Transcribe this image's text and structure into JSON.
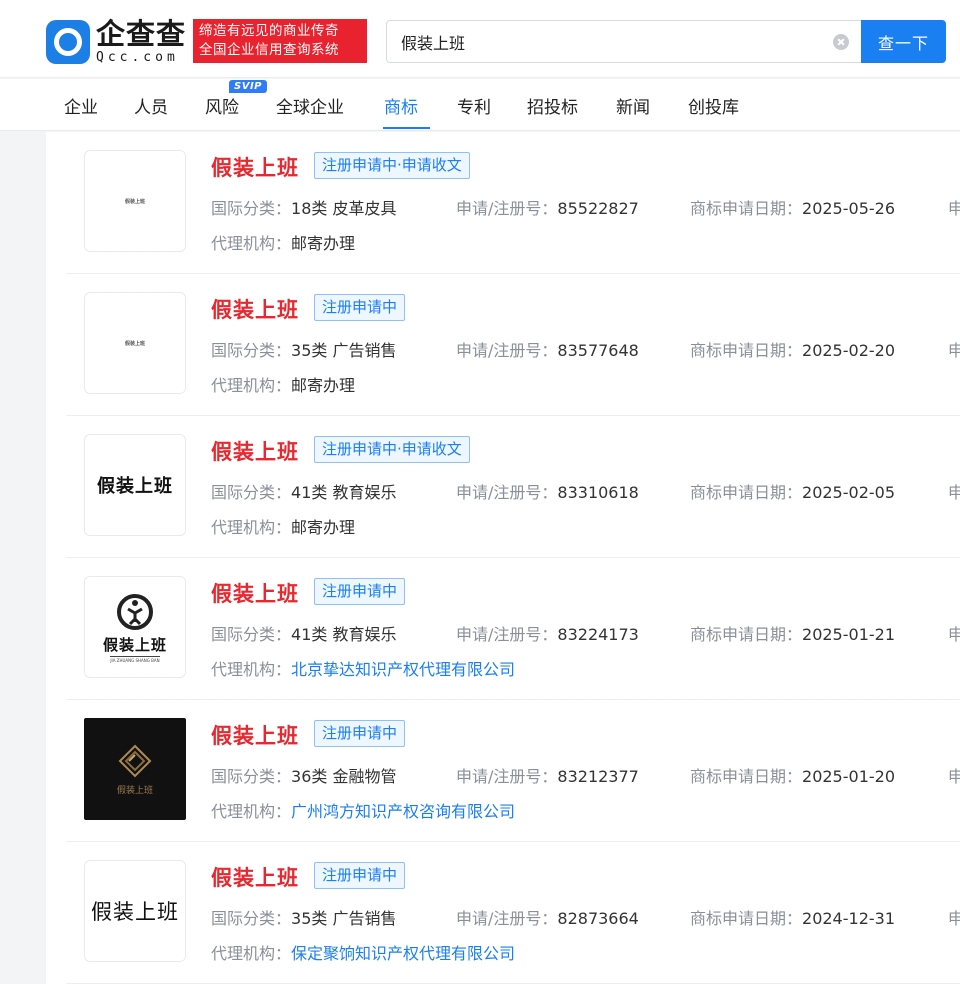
{
  "header": {
    "logo_name": "企查查",
    "logo_domain": "Qcc.com",
    "slogan_line1": "缔造有远见的商业传奇",
    "slogan_line2": "全国企业信用查询系统",
    "search_value": "假装上班",
    "search_button": "查一下"
  },
  "nav": {
    "svip": "SVIP",
    "tabs": [
      "企业",
      "人员",
      "风险",
      "全球企业",
      "商标",
      "专利",
      "招投标",
      "新闻",
      "创投库"
    ],
    "active": "商标"
  },
  "labels": {
    "class": "国际分类：",
    "regno": "申请/注册号：",
    "date": "商标申请日期：",
    "agency": "代理机构：",
    "cutoff": "申"
  },
  "items": [
    {
      "name": "假装上班",
      "status": "注册申请中·申请收文",
      "class": "18类 皮革皮具",
      "regno": "85522827",
      "date": "2025-05-26",
      "agency": "邮寄办理",
      "agency_link": false,
      "thumb_text": "假装上班",
      "thumb_style": "small"
    },
    {
      "name": "假装上班",
      "status": "注册申请中",
      "class": "35类 广告销售",
      "regno": "83577648",
      "date": "2025-02-20",
      "agency": "邮寄办理",
      "agency_link": false,
      "thumb_text": "假装上班",
      "thumb_style": "small"
    },
    {
      "name": "假装上班",
      "status": "注册申请中·申请收文",
      "class": "41类 教育娱乐",
      "regno": "83310618",
      "date": "2025-02-05",
      "agency": "邮寄办理",
      "agency_link": false,
      "thumb_text": "假装上班",
      "thumb_style": "big"
    },
    {
      "name": "假装上班",
      "status": "注册申请中",
      "class": "41类 教育娱乐",
      "regno": "83224173",
      "date": "2025-01-21",
      "agency": "北京挚达知识产权代理有限公司",
      "agency_link": true,
      "thumb_text": "假装上班",
      "thumb_sub": "JIA ZHUANG SHANG BAN",
      "thumb_style": "logo"
    },
    {
      "name": "假装上班",
      "status": "注册申请中",
      "class": "36类 金融物管",
      "regno": "83212377",
      "date": "2025-01-20",
      "agency": "广州鸿方知识产权咨询有限公司",
      "agency_link": true,
      "thumb_text": "假装上班",
      "thumb_style": "dark"
    },
    {
      "name": "假装上班",
      "status": "注册申请中",
      "class": "35类 广告销售",
      "regno": "82873664",
      "date": "2024-12-31",
      "agency": "保定聚饷知识产权代理有限公司",
      "agency_link": true,
      "thumb_text": "假装上班",
      "thumb_style": "plain"
    }
  ]
}
